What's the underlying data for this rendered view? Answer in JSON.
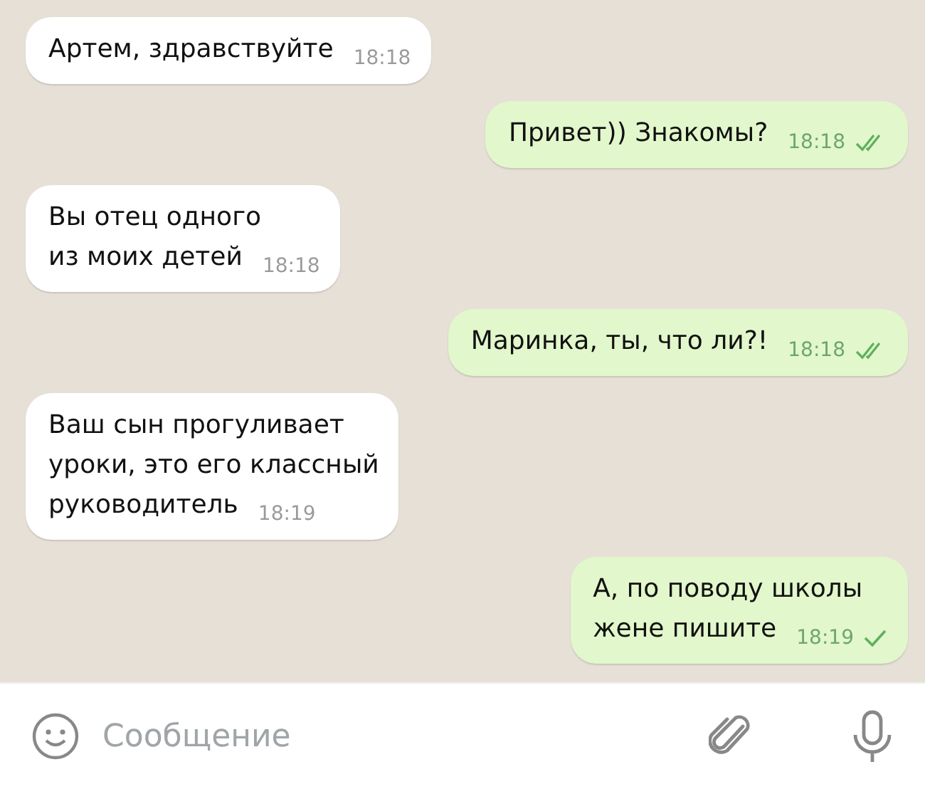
{
  "messages": [
    {
      "kind": "incoming",
      "text": "Артем, здравствуйте",
      "time": "18:18"
    },
    {
      "kind": "outgoing",
      "text": "Привет)) Знакомы?",
      "time": "18:18",
      "read": true
    },
    {
      "kind": "incoming",
      "text": "Вы отец одного\nиз моих детей",
      "time": "18:18"
    },
    {
      "kind": "outgoing",
      "text": "Маринка, ты, что ли?!",
      "time": "18:18",
      "read": true
    },
    {
      "kind": "incoming",
      "text": "Ваш сын прогуливает\nуроки, это его классный\nруководитель",
      "time": "18:19"
    },
    {
      "kind": "outgoing",
      "text": "А, по поводу школы\nжене пишите",
      "time": "18:19",
      "read": false
    }
  ],
  "composer": {
    "placeholder": "Сообщение"
  }
}
